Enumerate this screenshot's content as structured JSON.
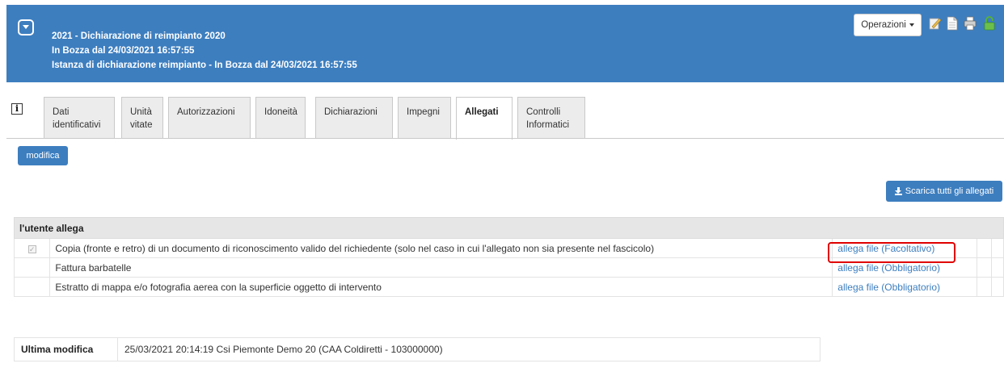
{
  "colors": {
    "primary": "#3d7ebf",
    "highlight": "#e00000",
    "link": "#3d7ebf"
  },
  "header": {
    "title": "2021 - Dichiarazione di reimpianto 2020",
    "status": "In Bozza dal 24/03/2021 16:57:55",
    "instance": "Istanza di dichiarazione reimpianto - In Bozza dal 24/03/2021 16:57:55",
    "operations_label": "Operazioni",
    "icons": [
      "edit-document-icon",
      "document-icon",
      "print-icon",
      "unlock-icon"
    ]
  },
  "tabs": [
    {
      "label": "Dati identificativi",
      "active": false
    },
    {
      "label": "Unità vitate",
      "active": false
    },
    {
      "label": "Autorizzazioni",
      "active": false
    },
    {
      "label": "Idoneità",
      "active": false
    },
    {
      "label": "Dichiarazioni",
      "active": false
    },
    {
      "label": "Impegni",
      "active": false
    },
    {
      "label": "Allegati",
      "active": true
    },
    {
      "label": "Controlli Informatici",
      "active": false
    }
  ],
  "buttons": {
    "modifica": "modifica",
    "download_all": "Scarica tutti gli allegati"
  },
  "attachments": {
    "section_title": "l'utente allega",
    "rows": [
      {
        "checked": true,
        "description": "Copia (fronte e retro) di un documento di riconoscimento valido del richiedente (solo nel caso in cui l'allegato non sia presente nel fascicolo)",
        "action": "allega file (Facoltativo)"
      },
      {
        "checked": false,
        "description": "Fattura barbatelle",
        "action": "allega file (Obbligatorio)"
      },
      {
        "checked": false,
        "description": "Estratto di mappa e/o fotografia aerea con la superficie oggetto di intervento",
        "action": "allega file (Obbligatorio)"
      }
    ]
  },
  "last_modified": {
    "label": "Ultima modifica",
    "value": "25/03/2021 20:14:19 Csi Piemonte Demo 20 (CAA Coldiretti - 103000000)"
  }
}
